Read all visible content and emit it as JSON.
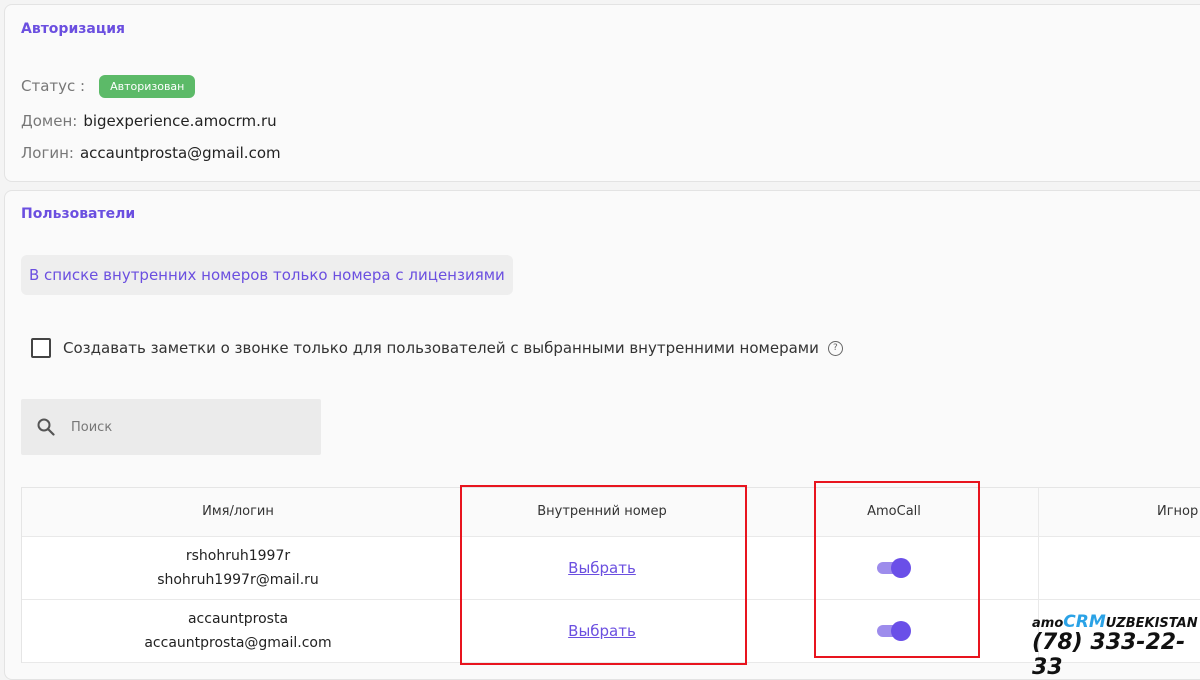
{
  "auth": {
    "title": "Авторизация",
    "status_label": "Статус :",
    "status_badge": "Авторизован",
    "domain_label": "Домен:",
    "domain_value": "bigexperience.amocrm.ru",
    "login_label": "Логин:",
    "login_value": "accauntprosta@gmail.com",
    "status_color": "#5cba68"
  },
  "users": {
    "title": "Пользователи",
    "info": "В списке внутренних номеров только номера с лицензиями",
    "checkbox_label": "Создавать заметки о звонке только для пользователей с выбранными внутренними номерами",
    "search_placeholder": "Поиск",
    "table": {
      "headers": [
        "Имя/логин",
        "Внутренний номер",
        "AmoCall",
        "Игнор"
      ],
      "rows": [
        {
          "name": "rshohruh1997r",
          "email": "shohruh1997r@mail.ru",
          "ext": "Выбрать",
          "amocall": true
        },
        {
          "name": "accauntprosta",
          "email": "accauntprosta@gmail.com",
          "ext": "Выбрать",
          "amocall": true
        }
      ]
    },
    "accent_color": "#6b4fe0"
  },
  "watermark": {
    "brand_prefix": "amo",
    "brand_crm": "CRM",
    "brand_suffix": "UZBEKISTAN",
    "phone": "(78) 333-22-33"
  }
}
